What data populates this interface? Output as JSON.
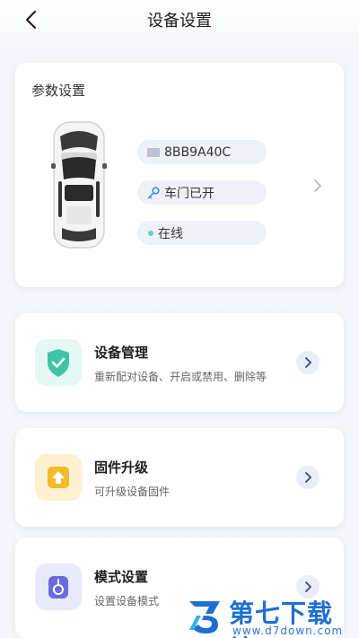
{
  "header": {
    "title": "设备设置"
  },
  "param_card": {
    "title": "参数设置",
    "device_id": "8BB9A40C",
    "door_status": "车门已开",
    "online_status": "在线"
  },
  "menu": [
    {
      "title": "设备管理",
      "subtitle": "重新配对设备、开启或禁用、删除等",
      "icon": "shield-check-icon"
    },
    {
      "title": "固件升级",
      "subtitle": "可升级设备固件",
      "icon": "upgrade-arrow-icon"
    },
    {
      "title": "模式设置",
      "subtitle": "设置设备模式",
      "icon": "lock-mode-icon"
    }
  ],
  "watermark": {
    "name": "第七下载站",
    "url": "www.d7down.com"
  },
  "colors": {
    "accent_green": "#3ec5a8",
    "accent_yellow": "#f2b92b",
    "accent_purple": "#6b6be0",
    "pill_bg": "#eef2f8"
  }
}
